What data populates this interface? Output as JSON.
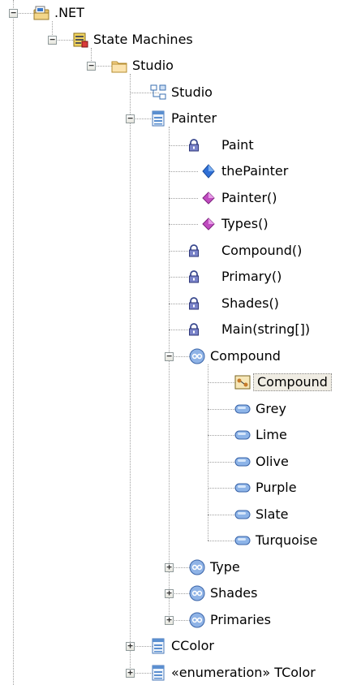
{
  "tree": {
    "nodes": [
      {
        "label": ".NET",
        "icon": "folder-dotnet-icon",
        "expander": "minus",
        "depth": 0
      },
      {
        "label": "State Machines",
        "icon": "state-machines-icon",
        "expander": "minus",
        "depth": 1
      },
      {
        "label": "Studio",
        "icon": "folder-icon",
        "expander": "minus",
        "depth": 2
      },
      {
        "label": "Studio",
        "icon": "diagram-icon",
        "expander": null,
        "depth": 3
      },
      {
        "label": "Painter",
        "icon": "class-icon",
        "expander": "minus",
        "depth": 3
      },
      {
        "label": "Paint",
        "icon": "locked-field-icon",
        "expander": null,
        "depth": 4,
        "lock": true
      },
      {
        "label": "thePainter",
        "icon": "field-icon",
        "expander": null,
        "depth": 4
      },
      {
        "label": "Painter()",
        "icon": "method-icon",
        "expander": null,
        "depth": 4
      },
      {
        "label": "Types()",
        "icon": "method-icon",
        "expander": null,
        "depth": 4
      },
      {
        "label": "Compound()",
        "icon": "locked-method-icon",
        "expander": null,
        "depth": 4,
        "lock": true
      },
      {
        "label": "Primary()",
        "icon": "locked-method-icon",
        "expander": null,
        "depth": 4,
        "lock": true
      },
      {
        "label": "Shades()",
        "icon": "locked-method-icon",
        "expander": null,
        "depth": 4,
        "lock": true
      },
      {
        "label": "Main(string[])",
        "icon": "locked-method-icon",
        "expander": null,
        "depth": 4,
        "lock": true
      },
      {
        "label": "Compound",
        "icon": "enum-icon",
        "expander": "minus",
        "depth": 4
      },
      {
        "label": "Compound",
        "icon": "state-diagram-icon",
        "expander": null,
        "depth": 5,
        "selected": true
      },
      {
        "label": "Grey",
        "icon": "state-icon",
        "expander": null,
        "depth": 5
      },
      {
        "label": "Lime",
        "icon": "state-icon",
        "expander": null,
        "depth": 5
      },
      {
        "label": "Olive",
        "icon": "state-icon",
        "expander": null,
        "depth": 5
      },
      {
        "label": "Purple",
        "icon": "state-icon",
        "expander": null,
        "depth": 5
      },
      {
        "label": "Slate",
        "icon": "state-icon",
        "expander": null,
        "depth": 5
      },
      {
        "label": "Turquoise",
        "icon": "state-icon",
        "expander": null,
        "depth": 5
      },
      {
        "label": "Type",
        "icon": "enum-icon",
        "expander": "plus",
        "depth": 4
      },
      {
        "label": "Shades",
        "icon": "enum-icon",
        "expander": "plus",
        "depth": 4
      },
      {
        "label": "Primaries",
        "icon": "enum-icon",
        "expander": "plus",
        "depth": 4
      },
      {
        "label": "CColor",
        "icon": "class-icon",
        "expander": "plus",
        "depth": 3
      },
      {
        "label": "«enumeration» TColor",
        "icon": "class-icon",
        "expander": "plus",
        "depth": 3
      }
    ]
  },
  "colors": {
    "selection_bg": "#f0ede4",
    "connector": "#a0a0a0",
    "method": "#c04cc0",
    "field": "#2f6fd6"
  }
}
